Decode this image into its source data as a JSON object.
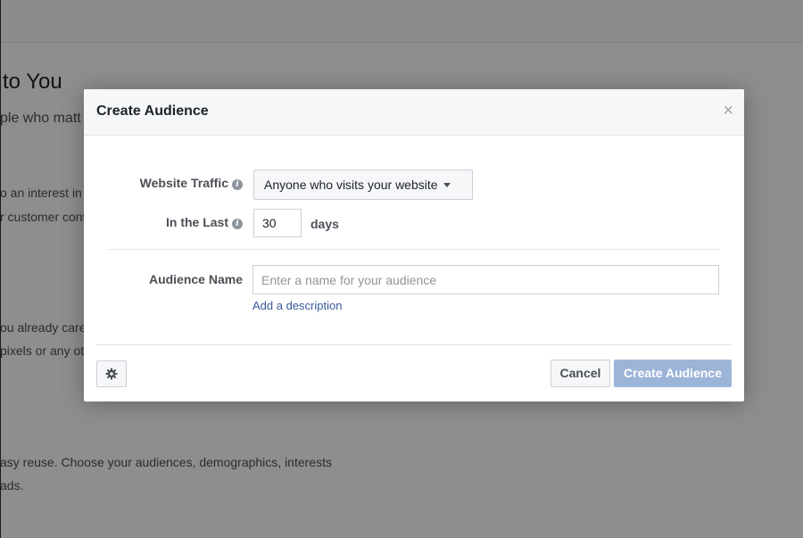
{
  "background": {
    "heading": "to You",
    "lines": [
      "ple who matt",
      "o an interest in",
      "r customer cont",
      "ou already care",
      "pixels or any ot",
      "asy reuse. Choose your audiences, demographics, interests",
      "ads."
    ]
  },
  "modal": {
    "title": "Create Audience",
    "close_glyph": "×",
    "website_traffic_label": "Website Traffic",
    "website_traffic_value": "Anyone who visits your website",
    "in_the_last_label": "In the Last",
    "days_value": "30",
    "days_label": "days",
    "audience_name_label": "Audience Name",
    "audience_name_placeholder": "Enter a name for your audience",
    "add_description_link": "Add a description",
    "cancel_label": "Cancel",
    "create_label": "Create Audience",
    "info_glyph": "i"
  },
  "colors": {
    "primary_button_disabled": "#9cb4d8",
    "link": "#365899",
    "overlay": "rgba(0,0,0,0.44)"
  }
}
